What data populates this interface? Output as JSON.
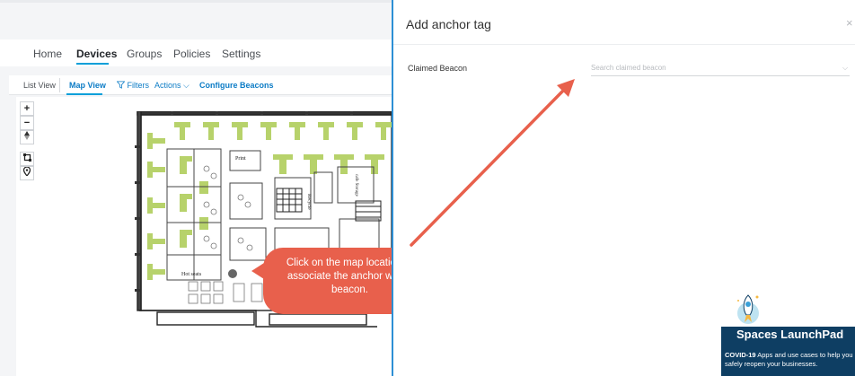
{
  "nav": {
    "tabs": [
      {
        "label": "Home"
      },
      {
        "label": "Devices"
      },
      {
        "label": "Groups"
      },
      {
        "label": "Policies"
      },
      {
        "label": "Settings"
      }
    ],
    "active_tab": "Devices"
  },
  "subnav": {
    "list_view": "List View",
    "map_view": "Map View",
    "filters": "Filters",
    "actions": "Actions",
    "configure": "Configure Beacons"
  },
  "map_controls": {
    "zoom_in": "+",
    "zoom_out": "−"
  },
  "floorplan_labels": {
    "print": "Print",
    "recycle": "Recycle",
    "hot_seats": "Hot seats",
    "cafe": "cafe Storage"
  },
  "tooltip": {
    "text": "Click on the map location to associate the anchor with a beacon."
  },
  "panel": {
    "title": "Add anchor tag",
    "close": "×",
    "field_label": "Claimed Beacon",
    "field_placeholder": "Search claimed beacon"
  },
  "launchpad": {
    "title": "Spaces LaunchPad",
    "desc_bold": "COVID-19",
    "desc_rest": " Apps and use cases to help you safely reopen your businesses."
  },
  "colors": {
    "accent": "#049fd9",
    "tooltip": "#e8604c",
    "desk_green": "#b7d26b",
    "launchpad_bg": "#0e3e63"
  }
}
